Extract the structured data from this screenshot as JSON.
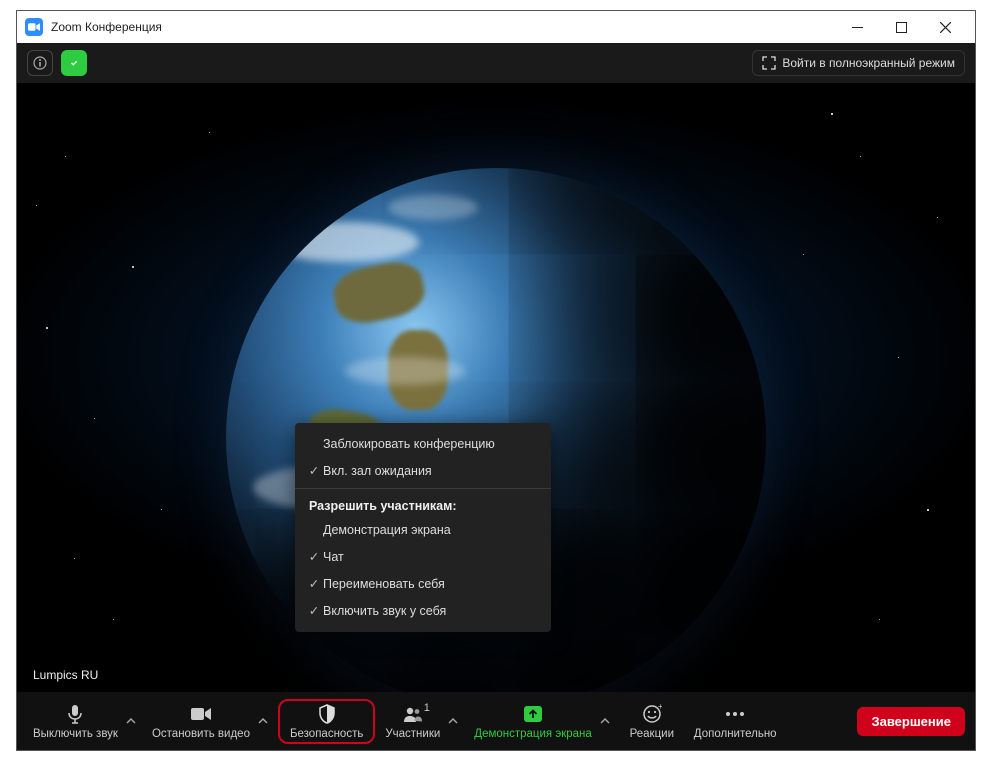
{
  "titlebar": {
    "title": "Zoom Конференция"
  },
  "topbar": {
    "fullscreen_label": "Войти в полноэкранный режим"
  },
  "nametag": "Lumpics RU",
  "security_menu": {
    "item_lock": "Заблокировать конференцию",
    "item_waiting": "Вкл. зал ожидания",
    "heading_allow": "Разрешить участникам:",
    "item_share": "Демонстрация экрана",
    "item_chat": "Чат",
    "item_rename": "Переименовать себя",
    "item_unmute": "Включить звук у себя"
  },
  "toolbar": {
    "mute": "Выключить звук",
    "video": "Остановить видео",
    "security": "Безопасность",
    "participants": "Участники",
    "participants_count": "1",
    "share": "Демонстрация экрана",
    "reactions": "Реакции",
    "more": "Дополнительно",
    "end": "Завершение"
  }
}
